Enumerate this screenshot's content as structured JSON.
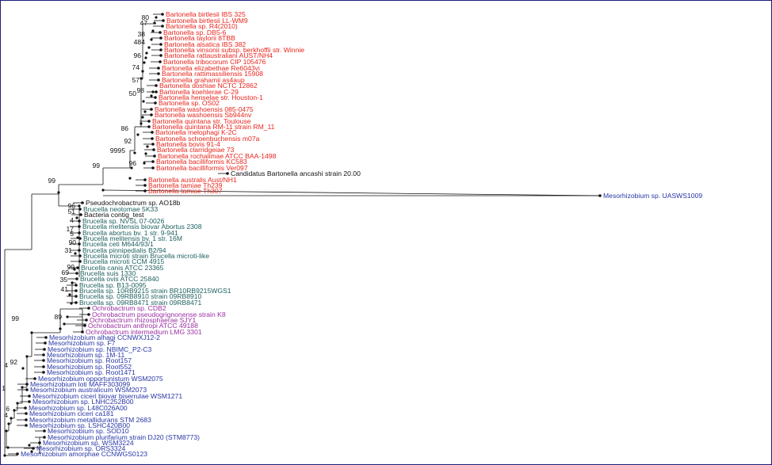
{
  "colors": {
    "bartonella": "#e8261d",
    "brucella": "#1f6060",
    "ochrobactrum": "#9b2fa4",
    "mesorhizobium": "#2736a6",
    "other": "#111111",
    "branch": "#111111"
  },
  "taxa": [
    {
      "name": "Bartonella birtlesii IBS 325",
      "group": "bartonella"
    },
    {
      "name": "Bartonella birtlesii LL-WM9",
      "group": "bartonella"
    },
    {
      "name": "Bartonella sp. R4(2010)",
      "group": "bartonella"
    },
    {
      "name": "Bartonella sp. DB5-6",
      "group": "bartonella"
    },
    {
      "name": "Bartonella taylorii 8TBB",
      "group": "bartonella"
    },
    {
      "name": "Bartonella alsatica IBS 382",
      "group": "bartonella"
    },
    {
      "name": "Bartonella vinsonii subsp. berkhoffii str. Winnie",
      "group": "bartonella"
    },
    {
      "name": "Bartonella rattaustraliani AUST/NH4",
      "group": "bartonella"
    },
    {
      "name": "Bartonella tribocorum CIP 105476",
      "group": "bartonella"
    },
    {
      "name": "Bartonella elizabethae Re6043vi",
      "group": "bartonella"
    },
    {
      "name": "Bartonella rattimassiliensis 15908",
      "group": "bartonella"
    },
    {
      "name": "Bartonella grahamii as4aup",
      "group": "bartonella"
    },
    {
      "name": "Bartonella doshiae NCTC 12862",
      "group": "bartonella"
    },
    {
      "name": "Bartonella koehlerae C-29",
      "group": "bartonella"
    },
    {
      "name": "Bartonella henselae str. Houston-1",
      "group": "bartonella"
    },
    {
      "name": "Bartonella sp. OS02",
      "group": "bartonella"
    },
    {
      "name": "Bartonella washoensis 085-0475",
      "group": "bartonella"
    },
    {
      "name": "Bartonella washoensis Sb944nv",
      "group": "bartonella"
    },
    {
      "name": "Bartonella quintana str. Toulouse",
      "group": "bartonella"
    },
    {
      "name": "Bartonella quintana RM-11 strain RM_11",
      "group": "bartonella"
    },
    {
      "name": "Bartonella melophagi K-2C",
      "group": "bartonella"
    },
    {
      "name": "Bartonella schoenbuchensis m07a",
      "group": "bartonella"
    },
    {
      "name": "Bartonella bovis 91-4",
      "group": "bartonella"
    },
    {
      "name": "Bartonella clarridgeiae 73",
      "group": "bartonella"
    },
    {
      "name": "Bartonella rochalimae ATCC BAA-1498",
      "group": "bartonella"
    },
    {
      "name": "Bartonella bacilliformis KC583",
      "group": "bartonella"
    },
    {
      "name": "Bartonella bacilliformis Ver097",
      "group": "bartonella"
    },
    {
      "name": "Candidatus Bartonella ancashi strain 20.00",
      "group": "other"
    },
    {
      "name": "Bartonella australis Aust/NH1",
      "group": "bartonella"
    },
    {
      "name": "Bartonella tamiae Th239",
      "group": "bartonella"
    },
    {
      "name": "Bartonella tamiae Th307",
      "group": "bartonella"
    },
    {
      "name": "Mesorhizobium sp. UASWS1009",
      "group": "mesorhizobium"
    },
    {
      "name": "Pseudochrobactrum sp. AO18b",
      "group": "other"
    },
    {
      "name": "Brucella neotomae 5K33",
      "group": "brucella"
    },
    {
      "name": "Bacteria contig_test",
      "group": "other"
    },
    {
      "name": "Brucella sp. NVSL 07-0026",
      "group": "brucella"
    },
    {
      "name": "Brucella melitensis biovar Abortus 2308",
      "group": "brucella"
    },
    {
      "name": "Brucella abortus bv. 1 str. 9-941",
      "group": "brucella"
    },
    {
      "name": "Brucella melitensis bv. 1 str. 16M",
      "group": "brucella"
    },
    {
      "name": "Brucella ceti M644/93/1",
      "group": "brucella"
    },
    {
      "name": "Brucella pinnipedialis B2/94",
      "group": "brucella"
    },
    {
      "name": "Brucella microti strain Brucella microti-like",
      "group": "brucella"
    },
    {
      "name": "Brucella microti CCM 4915",
      "group": "brucella"
    },
    {
      "name": "Brucella canis ATCC 23365",
      "group": "brucella"
    },
    {
      "name": "Brucella suis 1330",
      "group": "brucella"
    },
    {
      "name": "Brucella ovis ATCC 25840",
      "group": "brucella"
    },
    {
      "name": "Brucella sp. B13-0095",
      "group": "brucella"
    },
    {
      "name": "Brucella sp. 10RB9215 strain BR10RB9215WGS1",
      "group": "brucella"
    },
    {
      "name": "Brucella sp. 09RB8910 strain 09RB8910",
      "group": "brucella"
    },
    {
      "name": "Brucella sp. 09RB8471 strain 09RB8471",
      "group": "brucella"
    },
    {
      "name": "Ochrobactrum sp. CDB2",
      "group": "ochrobactrum"
    },
    {
      "name": "Ochrobactrum pseudogrignonense strain K8",
      "group": "ochrobactrum"
    },
    {
      "name": "Ochrobactrum rhizosphaerae SJY1",
      "group": "ochrobactrum"
    },
    {
      "name": "Ochrobactrum anthropi ATCC 49188",
      "group": "ochrobactrum"
    },
    {
      "name": "Ochrobactrum intermedium LMG 3301",
      "group": "ochrobactrum"
    },
    {
      "name": "Mesorhizobium alhagi CCNWXJ12-2",
      "group": "mesorhizobium"
    },
    {
      "name": "Mesorhizobium sp. F7",
      "group": "mesorhizobium"
    },
    {
      "name": "Mesorhizobium sp. NBIMC_P2-C3",
      "group": "mesorhizobium"
    },
    {
      "name": "Mesorhizobium sp. 1M-11",
      "group": "mesorhizobium"
    },
    {
      "name": "Mesorhizobium sp. Root157",
      "group": "mesorhizobium"
    },
    {
      "name": "Mesorhizobium sp. Root552",
      "group": "mesorhizobium"
    },
    {
      "name": "Mesorhizobium sp. Root1471",
      "group": "mesorhizobium"
    },
    {
      "name": "Mesorhizobium opportunistum WSM2075",
      "group": "mesorhizobium"
    },
    {
      "name": "Mesorhizobium loti MAFF303099",
      "group": "mesorhizobium"
    },
    {
      "name": "Mesorhizobium australicum WSM2073",
      "group": "mesorhizobium"
    },
    {
      "name": "Mesorhizobium ciceri biovar biserrulae WSM1271",
      "group": "mesorhizobium"
    },
    {
      "name": "Mesorhizobium sp. LNHC252B00",
      "group": "mesorhizobium"
    },
    {
      "name": "Mesorhizobium sp. L48C026A00",
      "group": "mesorhizobium"
    },
    {
      "name": "Mesorhizobium ciceri ca181",
      "group": "mesorhizobium"
    },
    {
      "name": "Mesorhizobium metallidurans STM 2683",
      "group": "mesorhizobium"
    },
    {
      "name": "Mesorhizobium sp. LSHC420B00",
      "group": "mesorhizobium"
    },
    {
      "name": "Mesorhizobium sp. SOD10",
      "group": "mesorhizobium"
    },
    {
      "name": "Mesorhizobium plurifarium strain DJ20 (STM8773)",
      "group": "mesorhizobium"
    },
    {
      "name": "Mesorhizobium sp. WSM3224",
      "group": "mesorhizobium"
    },
    {
      "name": "Mesorhizobium sp. ORS3324",
      "group": "mesorhizobium"
    },
    {
      "name": "Mesorhizobium amorphae CCNWGS0123",
      "group": "mesorhizobium"
    }
  ],
  "support_labels": [
    "80",
    "47",
    "38",
    "484",
    "96",
    "74",
    "57",
    "98",
    "50",
    "86",
    "92",
    "9995",
    "96",
    "99",
    "99",
    "96",
    "51",
    "4",
    "17",
    "5",
    "90",
    "31",
    "99",
    "69",
    "35",
    "41",
    "89",
    "99",
    "4",
    "92",
    "1",
    "6",
    "4"
  ]
}
